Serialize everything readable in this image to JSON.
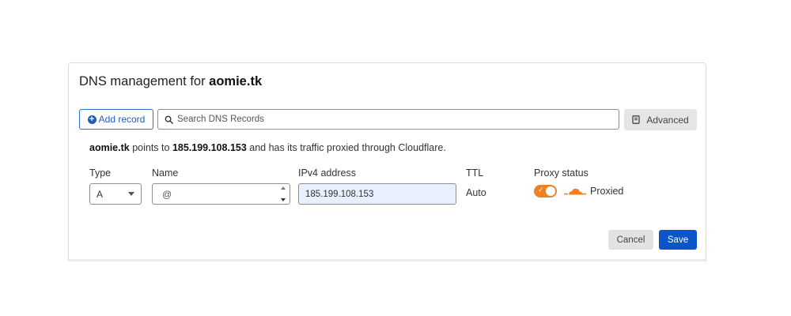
{
  "header": {
    "title_prefix": "DNS management for",
    "domain": "aomie.tk"
  },
  "toolbar": {
    "add_record_label": "Add record",
    "search_placeholder": "Search DNS Records",
    "search_value": "",
    "advanced_label": "Advanced"
  },
  "info": {
    "domain": "aomie.tk",
    "text_1": "points to",
    "ip": "185.199.108.153",
    "text_2": "and has its traffic proxied through Cloudflare."
  },
  "columns": {
    "type": "Type",
    "name": "Name",
    "ipv4": "IPv4 address",
    "ttl": "TTL",
    "proxy": "Proxy status"
  },
  "record": {
    "type": "A",
    "name": "@",
    "ipv4": "185.199.108.153",
    "ttl": "Auto",
    "proxy_status": "Proxied",
    "proxy_enabled": true
  },
  "actions": {
    "cancel_label": "Cancel",
    "save_label": "Save"
  },
  "colors": {
    "primary": "#0a55c8",
    "link": "#1f5ebd",
    "proxy_orange": "#f38020",
    "ip_field_bg": "#e8f0fe"
  },
  "icons": {
    "add": "plus-circle-icon",
    "search": "search-icon",
    "advanced": "book-icon",
    "select": "chevron-down-icon",
    "stepper": "stepper-icon",
    "toggle": "check-icon",
    "proxy": "cloud-icon"
  }
}
